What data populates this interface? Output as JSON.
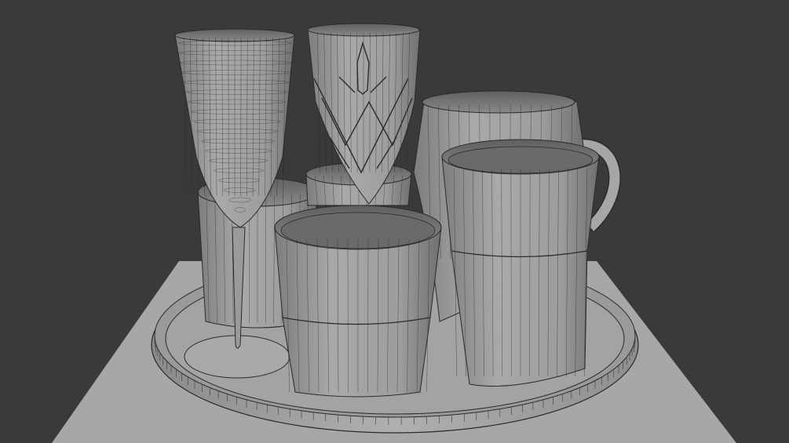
{
  "scene": {
    "description_visible_text": "",
    "background_color": "#3a3a3a",
    "floor_color": "#a9a9a9",
    "object_color": "#9c9c9c",
    "wire_color": "#2a2a2a"
  },
  "objects": [
    {
      "name": "champagne-flute",
      "icon": "flute-glass"
    },
    {
      "name": "crystal-wine-glass",
      "icon": "wine-glass"
    },
    {
      "name": "beer-mug",
      "icon": "mug"
    },
    {
      "name": "tumbler-back-left",
      "icon": "tumbler"
    },
    {
      "name": "tumbler-back-center",
      "icon": "tumbler"
    },
    {
      "name": "faceted-glass-front",
      "icon": "tumbler"
    },
    {
      "name": "tall-faceted-glass",
      "icon": "tumbler"
    },
    {
      "name": "round-tray",
      "icon": "tray"
    },
    {
      "name": "floor-plane",
      "icon": "plane"
    }
  ]
}
